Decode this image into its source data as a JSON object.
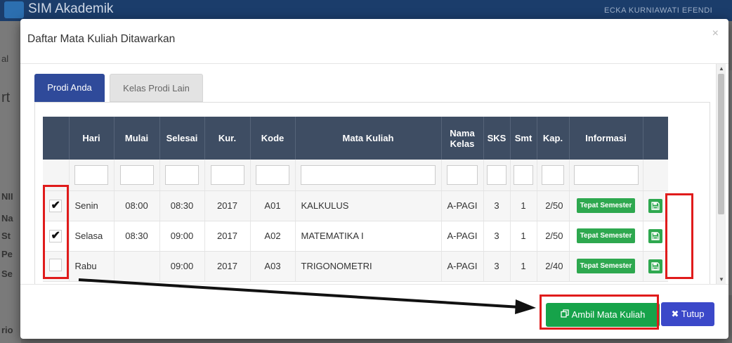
{
  "background": {
    "app_title": "SIM Akademik",
    "user_text": "ECKA KURNIAWATI EFENDI",
    "side_fragments": [
      "al",
      "rt",
      "NII",
      "Na",
      "St",
      "Pe",
      "Se",
      "rio"
    ]
  },
  "modal": {
    "title": "Daftar Mata Kuliah Ditawarkan",
    "close_symbol": "×"
  },
  "tabs": [
    {
      "label": "Prodi Anda",
      "active": true
    },
    {
      "label": "Kelas Prodi Lain",
      "active": false
    }
  ],
  "table": {
    "headers": [
      "",
      "Hari",
      "Mulai",
      "Selesai",
      "Kur.",
      "Kode",
      "Mata Kuliah",
      "Nama Kelas",
      "SKS",
      "Smt",
      "Kap.",
      "Informasi",
      ""
    ],
    "rows": [
      {
        "checked": true,
        "check_symbol": "✔",
        "hari": "Senin",
        "mulai": "08:00",
        "selesai": "08:30",
        "kur": "2017",
        "kode": "A01",
        "mata_kuliah": "KALKULUS",
        "nama_kelas": "A-PAGI",
        "sks": "3",
        "smt": "1",
        "kap": "2/50",
        "informasi": "Tepat Semester"
      },
      {
        "checked": true,
        "check_symbol": "✔",
        "hari": "Selasa",
        "mulai": "08:30",
        "selesai": "09:00",
        "kur": "2017",
        "kode": "A02",
        "mata_kuliah": "MATEMATIKA I",
        "nama_kelas": "A-PAGI",
        "sks": "3",
        "smt": "1",
        "kap": "2/50",
        "informasi": "Tepat Semester"
      },
      {
        "checked": false,
        "check_symbol": "",
        "hari": "Rabu",
        "mulai": "",
        "selesai": "09:00",
        "kur": "2017",
        "kode": "A03",
        "mata_kuliah": "TRIGONOMETRI",
        "nama_kelas": "A-PAGI",
        "sks": "3",
        "smt": "1",
        "kap": "2/40",
        "informasi": "Tepat Semester"
      }
    ]
  },
  "footer": {
    "ambil_label": "Ambil Mata Kuliah",
    "tutup_label": "Tutup",
    "tutup_symbol": "✖"
  },
  "colors": {
    "table_header": "#3e4d63",
    "success": "#16a34a",
    "primary": "#3b48c9",
    "tab_active": "#2f4a9a",
    "annotation": "#e01b1b"
  },
  "icons": {
    "save": "floppy-disk-icon",
    "ambil": "copy-icon",
    "tutup": "x-icon"
  }
}
